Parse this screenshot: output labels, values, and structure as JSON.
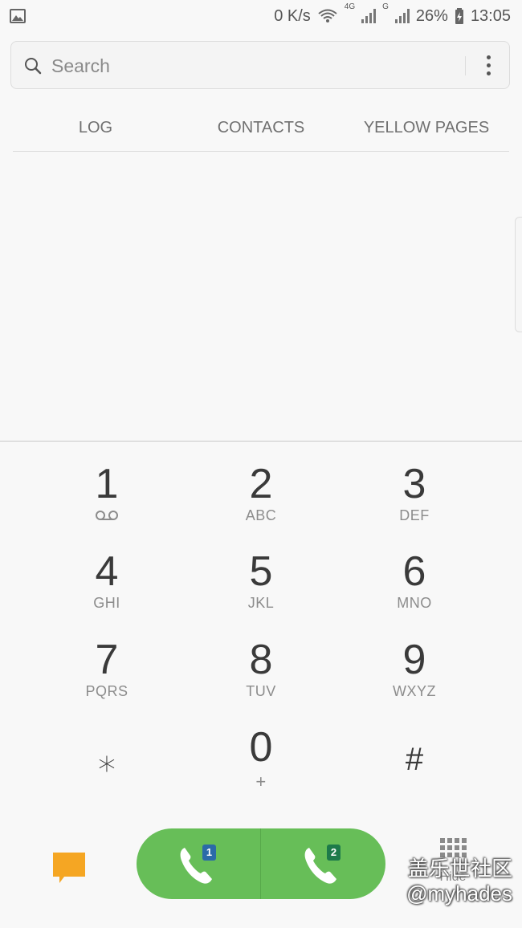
{
  "status_bar": {
    "network_speed": "0 K/s",
    "sim1_network": "4G",
    "sim2_network": "G",
    "battery": "26%",
    "time": "13:05"
  },
  "search": {
    "placeholder": "Search"
  },
  "tabs": [
    {
      "label": "LOG"
    },
    {
      "label": "CONTACTS"
    },
    {
      "label": "YELLOW PAGES"
    }
  ],
  "dialpad": {
    "keys": [
      {
        "digit": "1",
        "letters": "",
        "icon": "voicemail-icon"
      },
      {
        "digit": "2",
        "letters": "ABC"
      },
      {
        "digit": "3",
        "letters": "DEF"
      },
      {
        "digit": "4",
        "letters": "GHI"
      },
      {
        "digit": "5",
        "letters": "JKL"
      },
      {
        "digit": "6",
        "letters": "MNO"
      },
      {
        "digit": "7",
        "letters": "PQRS"
      },
      {
        "digit": "8",
        "letters": "TUV"
      },
      {
        "digit": "9",
        "letters": "WXYZ"
      },
      {
        "digit": "⁎",
        "letters": ""
      },
      {
        "digit": "0",
        "letters": "+"
      },
      {
        "digit": "#",
        "letters": ""
      }
    ]
  },
  "bottom": {
    "sim1_badge": "1",
    "sim2_badge": "2",
    "hide_label": "Hide",
    "watermark_line1": "盖乐世社区",
    "watermark_line2": "@myhades"
  },
  "colors": {
    "call_green": "#67be58",
    "sim1_blue": "#2b6aa8",
    "sim2_green": "#1d7a4a",
    "message_orange": "#f5a623"
  }
}
